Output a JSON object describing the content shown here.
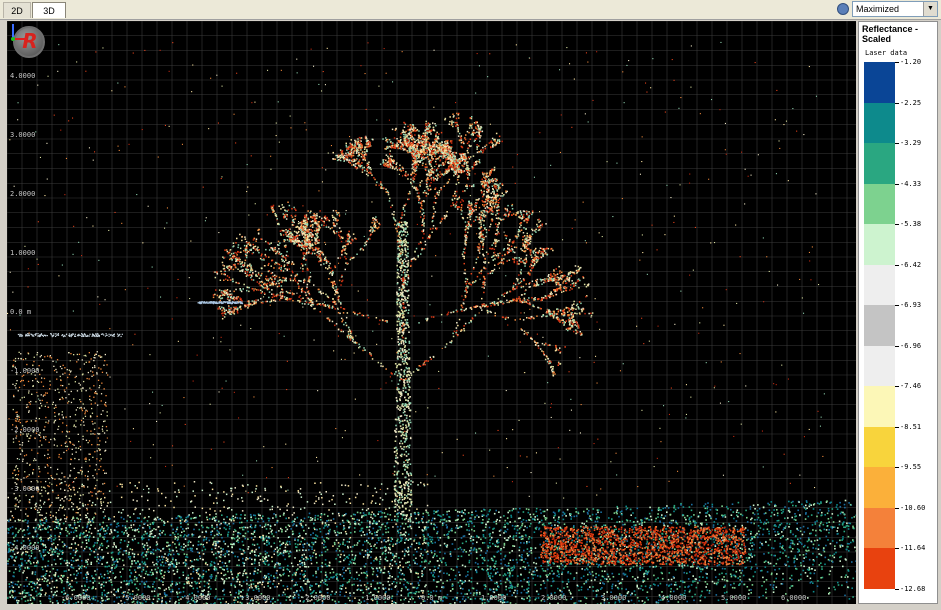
{
  "tabs": [
    {
      "label": "2D",
      "active": false
    },
    {
      "label": "3D",
      "active": true
    }
  ],
  "view_mode": {
    "selected": "Maximized",
    "icon": "view-icon"
  },
  "viewport": {
    "y_axis_labels": [
      "4.0000",
      "3.0000",
      "2.0000",
      "1.0000",
      "0.0 m",
      "-1.0000",
      "-2.0000",
      "-3.0000",
      "-4.0000"
    ],
    "x_axis_labels": [
      "-6.0000",
      "-5.0000",
      "-4.0000",
      "-3.0000",
      "-2.0000",
      "-1.0000",
      "0.0 m",
      "1.0000",
      "2.0000",
      "3.0000",
      "4.0000",
      "5.0000",
      "6.0000"
    ],
    "background": "#000000",
    "grid_color": "#3a3a3a"
  },
  "legend": {
    "title": "Reflectance - Scaled",
    "subtitle": "Laser data",
    "labels": [
      "-1.20",
      "-2.25",
      "-3.29",
      "-4.33",
      "-5.38",
      "-6.42",
      "-6.93",
      "-6.96",
      "-7.46",
      "-8.51",
      "-9.55",
      "-10.60",
      "-11.64",
      "-12.68"
    ],
    "colors": [
      "#0a4596",
      "#0d8a8c",
      "#2aa781",
      "#7dd28f",
      "#cdf3cf",
      "#eeeeee",
      "#c4c4c4",
      "#eeeeee",
      "#fcf7b7",
      "#f8d43c",
      "#fbb03a",
      "#f4813a",
      "#e8420f",
      "#9e0504"
    ]
  },
  "colors": {
    "branch_palette": [
      "#f0e8c8",
      "#d9dfa0",
      "#8fd3b0",
      "#f08a3c",
      "#e8431a",
      "#c42a10",
      "#fbe3a0"
    ],
    "ground_palette": [
      "#0d8a8c",
      "#2aa781",
      "#1b6fa0",
      "#7dd28f",
      "#cdf3cf"
    ],
    "patch_palette": [
      "#e8420f",
      "#f4813a",
      "#c42a10"
    ]
  }
}
